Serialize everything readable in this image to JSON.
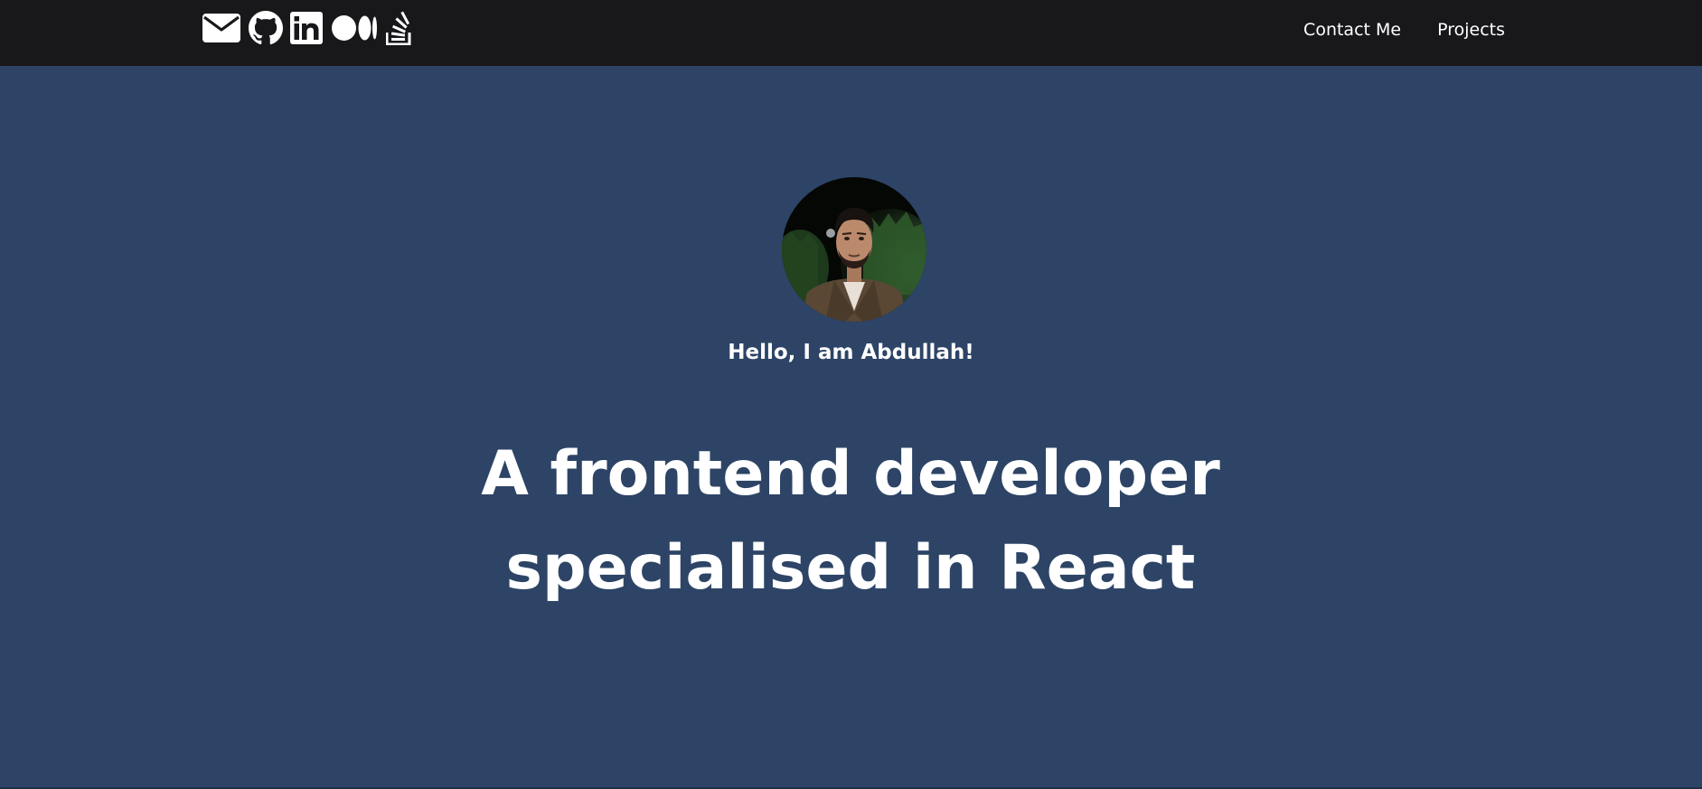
{
  "nav": {
    "social": [
      {
        "name": "email",
        "icon": "envelope-icon"
      },
      {
        "name": "github",
        "icon": "github-icon"
      },
      {
        "name": "linkedin",
        "icon": "linkedin-icon"
      },
      {
        "name": "medium",
        "icon": "medium-icon"
      },
      {
        "name": "stackoverflow",
        "icon": "stackoverflow-icon"
      }
    ],
    "links": {
      "contact": "Contact Me",
      "projects": "Projects"
    }
  },
  "hero": {
    "avatar_icon": "profile-photo",
    "greeting": "Hello, I am Abdullah!",
    "headline_line1": "A frontend developer",
    "headline_line2": "specialised in React"
  },
  "colors": {
    "navbar_bg": "#18181b",
    "hero_bg": "#2d4466",
    "text": "#ffffff"
  }
}
